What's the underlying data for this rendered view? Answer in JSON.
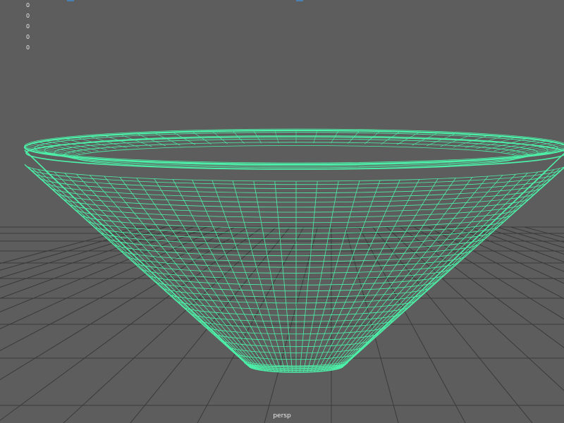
{
  "viewport": {
    "camera_name": "persp",
    "hud_values": [
      "0",
      "0",
      "0",
      "0",
      "0"
    ],
    "background_color": "#5d5d5d",
    "grid_color": "#3a3a3a",
    "wireframe_color": "#4df0a8",
    "hud_text_color": "#ededed"
  }
}
